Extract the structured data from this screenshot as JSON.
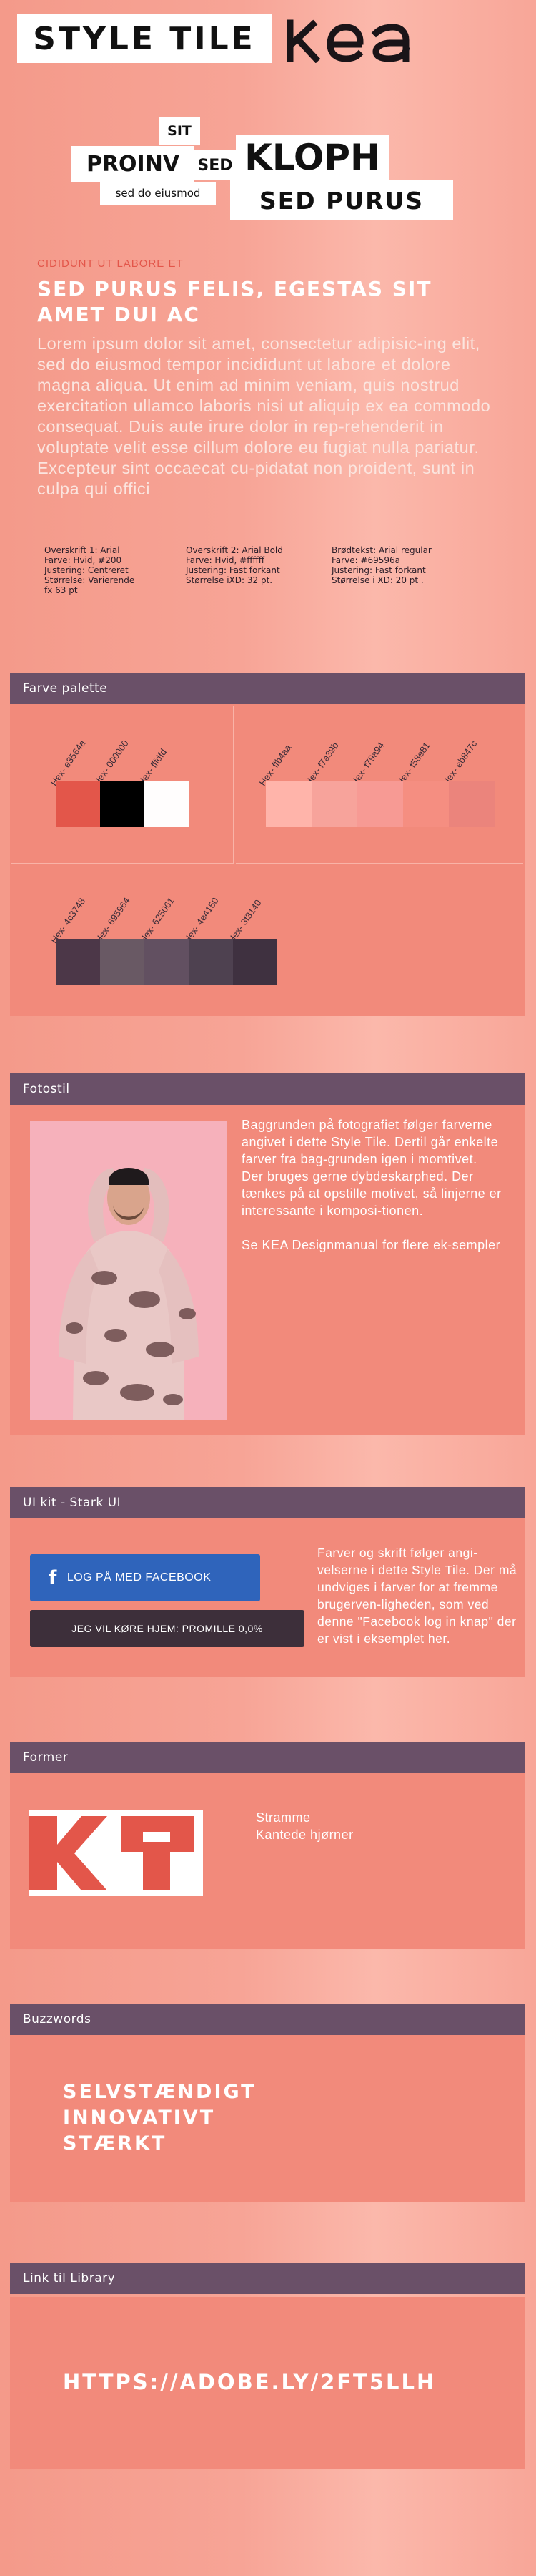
{
  "header": {
    "title": "STYLE TILE",
    "logo_text": "KEA"
  },
  "words": {
    "sit": "SIT",
    "proinv": "PROINV",
    "sed": "SED",
    "kloph": "KLOPH",
    "sed_do": "sed do eiusmod",
    "sed_purus": "SED PURUS"
  },
  "hero": {
    "eyebrow": "CIDIDUNT UT LABORE ET",
    "heading": "SED PURUS FELIS, EGESTAS SIT AMET DUI AC",
    "paragraph": "Lorem ipsum dolor sit amet, consectetur adipisic-ing elit, sed do eiusmod tempor incididunt ut labore et dolore magna  aliqua. Ut enim ad minim veniam, quis nostrud exercitation ullamco laboris nisi ut aliquip ex ea commodo consequat. Duis aute irure dolor in rep-rehenderit in voluptate velit esse cillum dolore eu fugiat nulla pariatur. Excepteur sint occaecat cu-pidatat non proident, sunt in culpa qui offici"
  },
  "specs": [
    "Overskrift 1: Arial\nFarve: Hvid, #200\nJustering: Centreret\nStørrelse: Varierende\nfx 63 pt",
    "Overskrift 2: Arial Bold\nFarve: Hvid, #ffffff\nJustering: Fast forkant\nStørrelse iXD: 32 pt.",
    "Brødtekst: Arial regular\nFarve: #69596a\nJustering: Fast forkant\nStørrelse i XD: 20 pt ."
  ],
  "palette": {
    "title": "Farve palette",
    "group1": [
      {
        "label": "Hex- e3564a",
        "color": "#e3564a"
      },
      {
        "label": "Hex- 000000",
        "color": "#000000"
      },
      {
        "label": "Hex- fffdfd",
        "color": "#fffdfd"
      }
    ],
    "group2": [
      {
        "label": "Hex- ffb4aa",
        "color": "#ffb4aa"
      },
      {
        "label": "Hex- f7a39b",
        "color": "#f7a39b"
      },
      {
        "label": "Hex- f79a94",
        "color": "#f79a94"
      },
      {
        "label": "Hex- f58e81",
        "color": "#f58e81"
      },
      {
        "label": "Hex- eb847c",
        "color": "#eb847c"
      }
    ],
    "group3": [
      {
        "label": "Hex- 4c3748",
        "color": "#4c3748"
      },
      {
        "label": "Hex- 695964",
        "color": "#695964"
      },
      {
        "label": "Hex- 625061",
        "color": "#625061"
      },
      {
        "label": "Hex- 4e4150",
        "color": "#4e4150"
      },
      {
        "label": "Hex- 3f3140",
        "color": "#3f3140"
      }
    ]
  },
  "fotostil": {
    "title": "Fotostil",
    "text": "Baggrunden på fotografiet følger farverne angivet i dette Style Tile. Dertil går enkelte farver fra bag-grunden igen i momtivet.\nDer bruges gerne dybdeskarphed. Der tænkes på at opstille motivet, så linjerne er interessante i komposi-tionen.\n\nSe KEA Designmanual for flere ek-sempler"
  },
  "uikit": {
    "title": "UI kit - Stark UI",
    "fb_button": "LOG PÅ MED FACEBOOK",
    "dark_button": "JEG VIL KØRE HJEM: PROMILLE 0,0%",
    "text": "Farver og skrift følger angi-velserne i dette Style Tile. Der må undviges i farver for at fremme brugerven-ligheden, som ved denne \"Facebook log in knap\" der er vist i eksemplet her."
  },
  "former": {
    "title": "Former",
    "line1": "Stramme",
    "line2": "Kantede hjørner"
  },
  "buzzwords": {
    "title": "Buzzwords",
    "items": [
      "SELVSTÆNDIGT",
      "INNOVATIVT",
      "STÆRKT"
    ]
  },
  "library": {
    "title": "Link til Library",
    "url": "HTTPS://ADOBE.LY/2FT5LLH"
  }
}
